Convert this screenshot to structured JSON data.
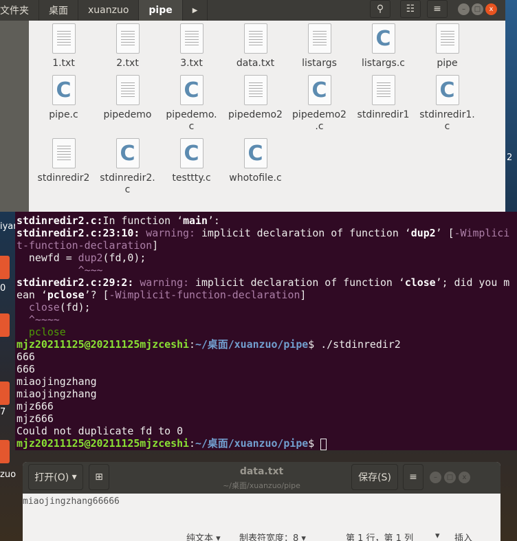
{
  "files": {
    "breadcrumbs": [
      "文件夹",
      "桌面",
      "xuanzuo",
      "pipe"
    ],
    "active_crumb": "pipe",
    "icons": [
      "search-icon",
      "list-view-icon",
      "menu-icon"
    ],
    "items": [
      {
        "name": "1.txt",
        "type": "txt"
      },
      {
        "name": "2.txt",
        "type": "txt"
      },
      {
        "name": "3.txt",
        "type": "txt"
      },
      {
        "name": "data.txt",
        "type": "txt"
      },
      {
        "name": "listargs",
        "type": "txt"
      },
      {
        "name": "listargs.c",
        "type": "c"
      },
      {
        "name": "pipe",
        "type": "txt"
      },
      {
        "name": "pipe.c",
        "type": "c"
      },
      {
        "name": "pipedemo",
        "type": "txt"
      },
      {
        "name": "pipedemo.\nc",
        "type": "c"
      },
      {
        "name": "pipedemo2",
        "type": "txt"
      },
      {
        "name": "pipedemo2\n.c",
        "type": "c"
      },
      {
        "name": "stdinredir1",
        "type": "txt"
      },
      {
        "name": "stdinredir1.\nc",
        "type": "c"
      },
      {
        "name": "stdinredir2",
        "type": "txt"
      },
      {
        "name": "stdinredir2.\nc",
        "type": "c"
      },
      {
        "name": "testtty.c",
        "type": "c"
      },
      {
        "name": "whotofile.c",
        "type": "c"
      }
    ]
  },
  "desktop": {
    "labels": [
      "iyar",
      "0",
      "7",
      "zuo"
    ],
    "right_label": "2"
  },
  "terminal": {
    "lines": [
      [
        [
          "b",
          "stdinredir2.c:"
        ],
        [
          "",
          "In function ‘"
        ],
        [
          "b",
          "main"
        ],
        [
          "",
          "’:"
        ]
      ],
      [
        [
          "b",
          "stdinredir2.c:23:10: "
        ],
        [
          "w",
          "warning: "
        ],
        [
          "",
          "implicit declaration of function ‘"
        ],
        [
          "b",
          "dup2"
        ],
        [
          "",
          "’ ["
        ],
        [
          "m",
          "-Wimplici"
        ]
      ],
      [
        [
          "m",
          "t-function-declaration"
        ],
        [
          "",
          "]"
        ]
      ],
      [
        [
          "",
          "  newfd = "
        ],
        [
          "m",
          "dup2"
        ],
        [
          "",
          "(fd,0);"
        ]
      ],
      [
        [
          "m",
          "          ^~~~"
        ]
      ],
      [
        [
          "b",
          "stdinredir2.c:29:2: "
        ],
        [
          "w",
          "warning: "
        ],
        [
          "",
          "implicit declaration of function ‘"
        ],
        [
          "b",
          "close"
        ],
        [
          "",
          "’; did you m"
        ]
      ],
      [
        [
          "",
          "ean ‘"
        ],
        [
          "b",
          "pclose"
        ],
        [
          "",
          "’? ["
        ],
        [
          "m",
          "-Wimplicit-function-declaration"
        ],
        [
          "",
          "]"
        ]
      ],
      [
        [
          "m",
          "  close"
        ],
        [
          "",
          "(fd);"
        ]
      ],
      [
        [
          "m",
          "  ^~~~~"
        ]
      ],
      [
        [
          "g",
          "  pclose"
        ]
      ],
      [
        [
          "pu",
          "mjz20211125@20211125mjzceshi"
        ],
        [
          "",
          ":"
        ],
        [
          "pp",
          "~/桌面/xuanzuo/pipe"
        ],
        [
          "",
          "$ ./stdinredir2"
        ]
      ],
      [
        [
          "",
          "666"
        ]
      ],
      [
        [
          "",
          "666"
        ]
      ],
      [
        [
          "",
          "miaojingzhang"
        ]
      ],
      [
        [
          "",
          "miaojingzhang"
        ]
      ],
      [
        [
          "",
          "mjz666"
        ]
      ],
      [
        [
          "",
          "mjz666"
        ]
      ],
      [
        [
          "",
          "Could not duplicate fd to 0"
        ]
      ],
      [
        [
          "pu",
          "mjz20211125@20211125mjzceshi"
        ],
        [
          "",
          ":"
        ],
        [
          "pp",
          "~/桌面/xuanzuo/pipe"
        ],
        [
          "",
          "$ "
        ],
        [
          "cursor",
          ""
        ]
      ]
    ]
  },
  "gedit": {
    "open_label": "打开(O)",
    "title": "data.txt",
    "path": "~/桌面/xuanzuo/pipe",
    "save_label": "保存(S)",
    "content": "miaojingzhang66666",
    "status": {
      "syntax": "纯文本 ▾",
      "tab_width": "制表符宽度：8 ▾",
      "position": "第 1 行，第 1 列",
      "mode": "▾",
      "insert": "插入"
    }
  }
}
